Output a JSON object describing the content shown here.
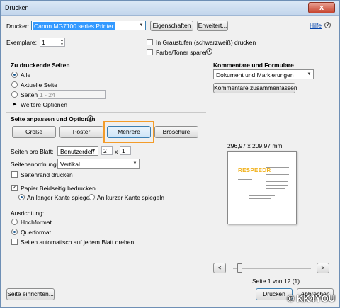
{
  "window": {
    "title": "Drucken",
    "close_label": "x"
  },
  "printer": {
    "label": "Drucker:",
    "selected": "Canon MG7100 series Printer",
    "properties_label": "Eigenschaften",
    "advanced_label": "Erweitert...",
    "help_label": "Hilfe",
    "copies_label": "Exemplare:",
    "copies_value": "1",
    "grayscale_label": "In Graustufen (schwarzweiß) drucken",
    "save_ink_label": "Farbe/Toner sparen"
  },
  "pages": {
    "heading": "Zu druckende Seiten",
    "options": [
      {
        "label": "Alle",
        "checked": true
      },
      {
        "label": "Aktuelle Seite",
        "checked": false
      },
      {
        "label": "Seiten",
        "checked": false
      }
    ],
    "range_placeholder": "1 - 24",
    "more_options_label": "Weitere Optionen"
  },
  "sizing": {
    "heading": "Seite anpassen und Optionen",
    "tabs": [
      "Größe",
      "Poster",
      "Mehrere",
      "Broschüre"
    ],
    "pages_per_sheet_label": "Seiten pro Blatt:",
    "pages_per_sheet_value": "Benutzerdefi",
    "grid_cols": "2",
    "grid_x": "x",
    "grid_rows": "1",
    "order_label": "Seitenanordnung:",
    "order_value": "Vertikal",
    "border_label": "Seitenrand drucken",
    "duplex_label": "Papier Beidseitig bedrucken",
    "long_edge_label": "An langer Kante spiegeln",
    "short_edge_label": "An kurzer Kante spiegeln"
  },
  "orientation": {
    "heading": "Ausrichtung:",
    "portrait_label": "Hochformat",
    "landscape_label": "Querformat",
    "auto_rotate_label": "Seiten automatisch auf jedem Blatt drehen"
  },
  "comments": {
    "heading": "Kommentare und Formulare",
    "selected": "Dokument und Markierungen",
    "summarize_label": "Kommentare zusammenfassen"
  },
  "preview": {
    "dimensions": "296,97 x 209,97 mm",
    "logo_text": "RESPEEDR",
    "page_info": "Seite 1 von 12 (1)",
    "prev_label": "<",
    "next_label": ">"
  },
  "footer": {
    "page_setup_label": "Seite einrichten...",
    "print_label": "Drucken",
    "cancel_label": "Abbrechen"
  },
  "watermark": "© KK4YOU",
  "colors": {
    "highlight": "#f39c2a",
    "selection": "#3399ff"
  }
}
